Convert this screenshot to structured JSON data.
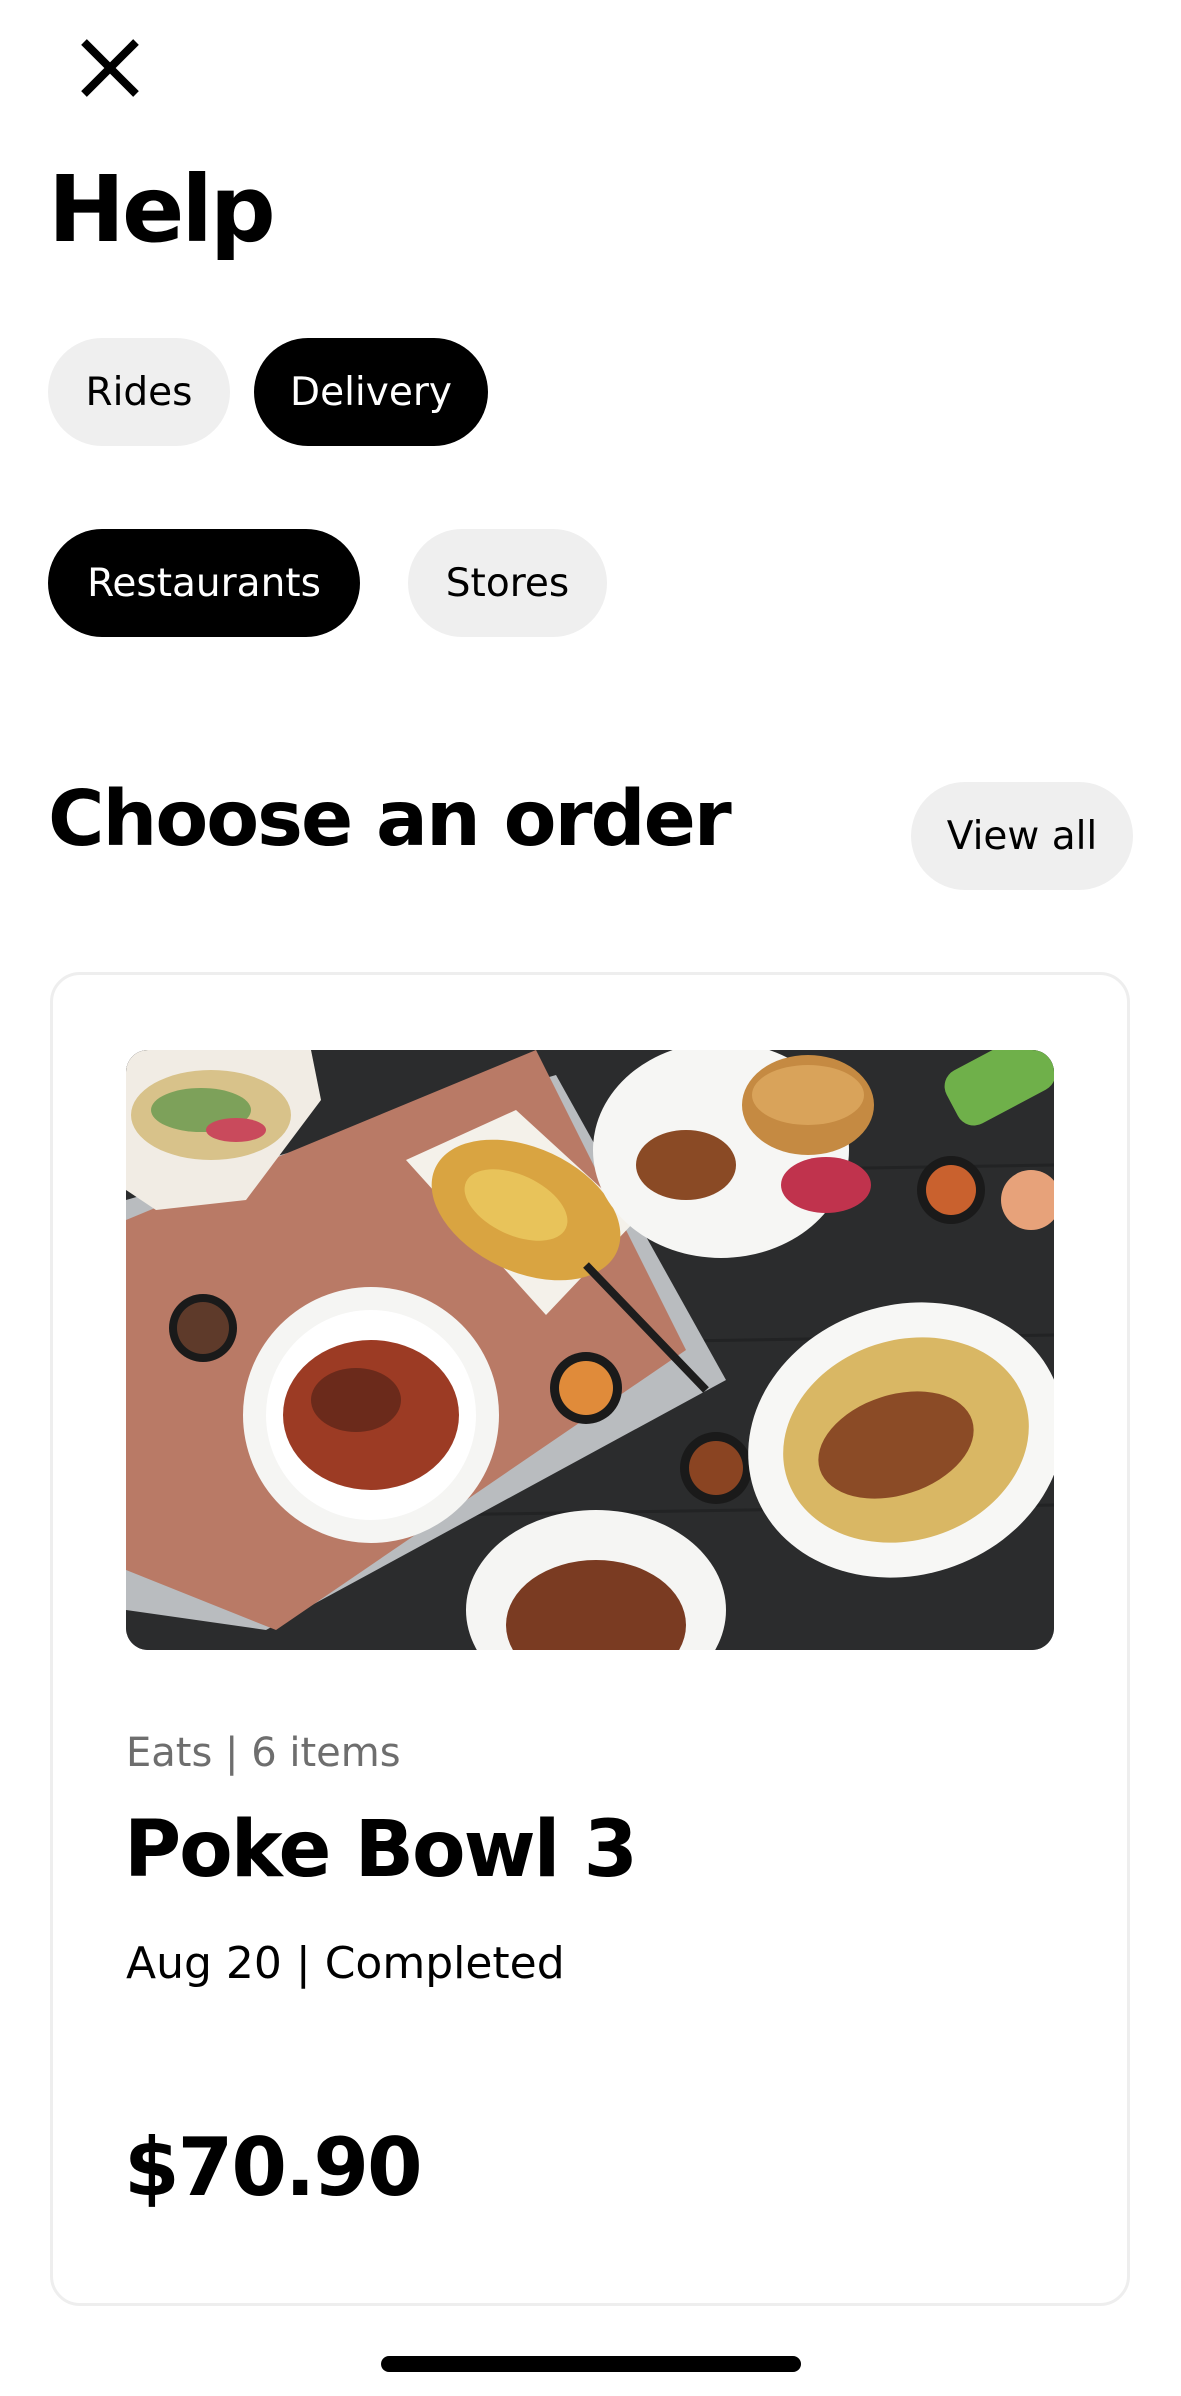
{
  "header": {
    "close_icon": "close-icon",
    "title": "Help"
  },
  "category_tabs": [
    {
      "label": "Rides",
      "selected": false
    },
    {
      "label": "Delivery",
      "selected": true
    }
  ],
  "sub_tabs": [
    {
      "label": "Restaurants",
      "selected": true
    },
    {
      "label": "Stores",
      "selected": false
    }
  ],
  "orders_section": {
    "title": "Choose an order",
    "view_all_label": "View all"
  },
  "order": {
    "meta": "Eats | 6 items",
    "name": "Poke Bowl 3",
    "status": "Aug 20 | Completed",
    "price": "$70.90"
  },
  "colors": {
    "selected_pill": "#000000",
    "unselected_pill": "#efefef",
    "meta_text": "#6e6e6e"
  }
}
